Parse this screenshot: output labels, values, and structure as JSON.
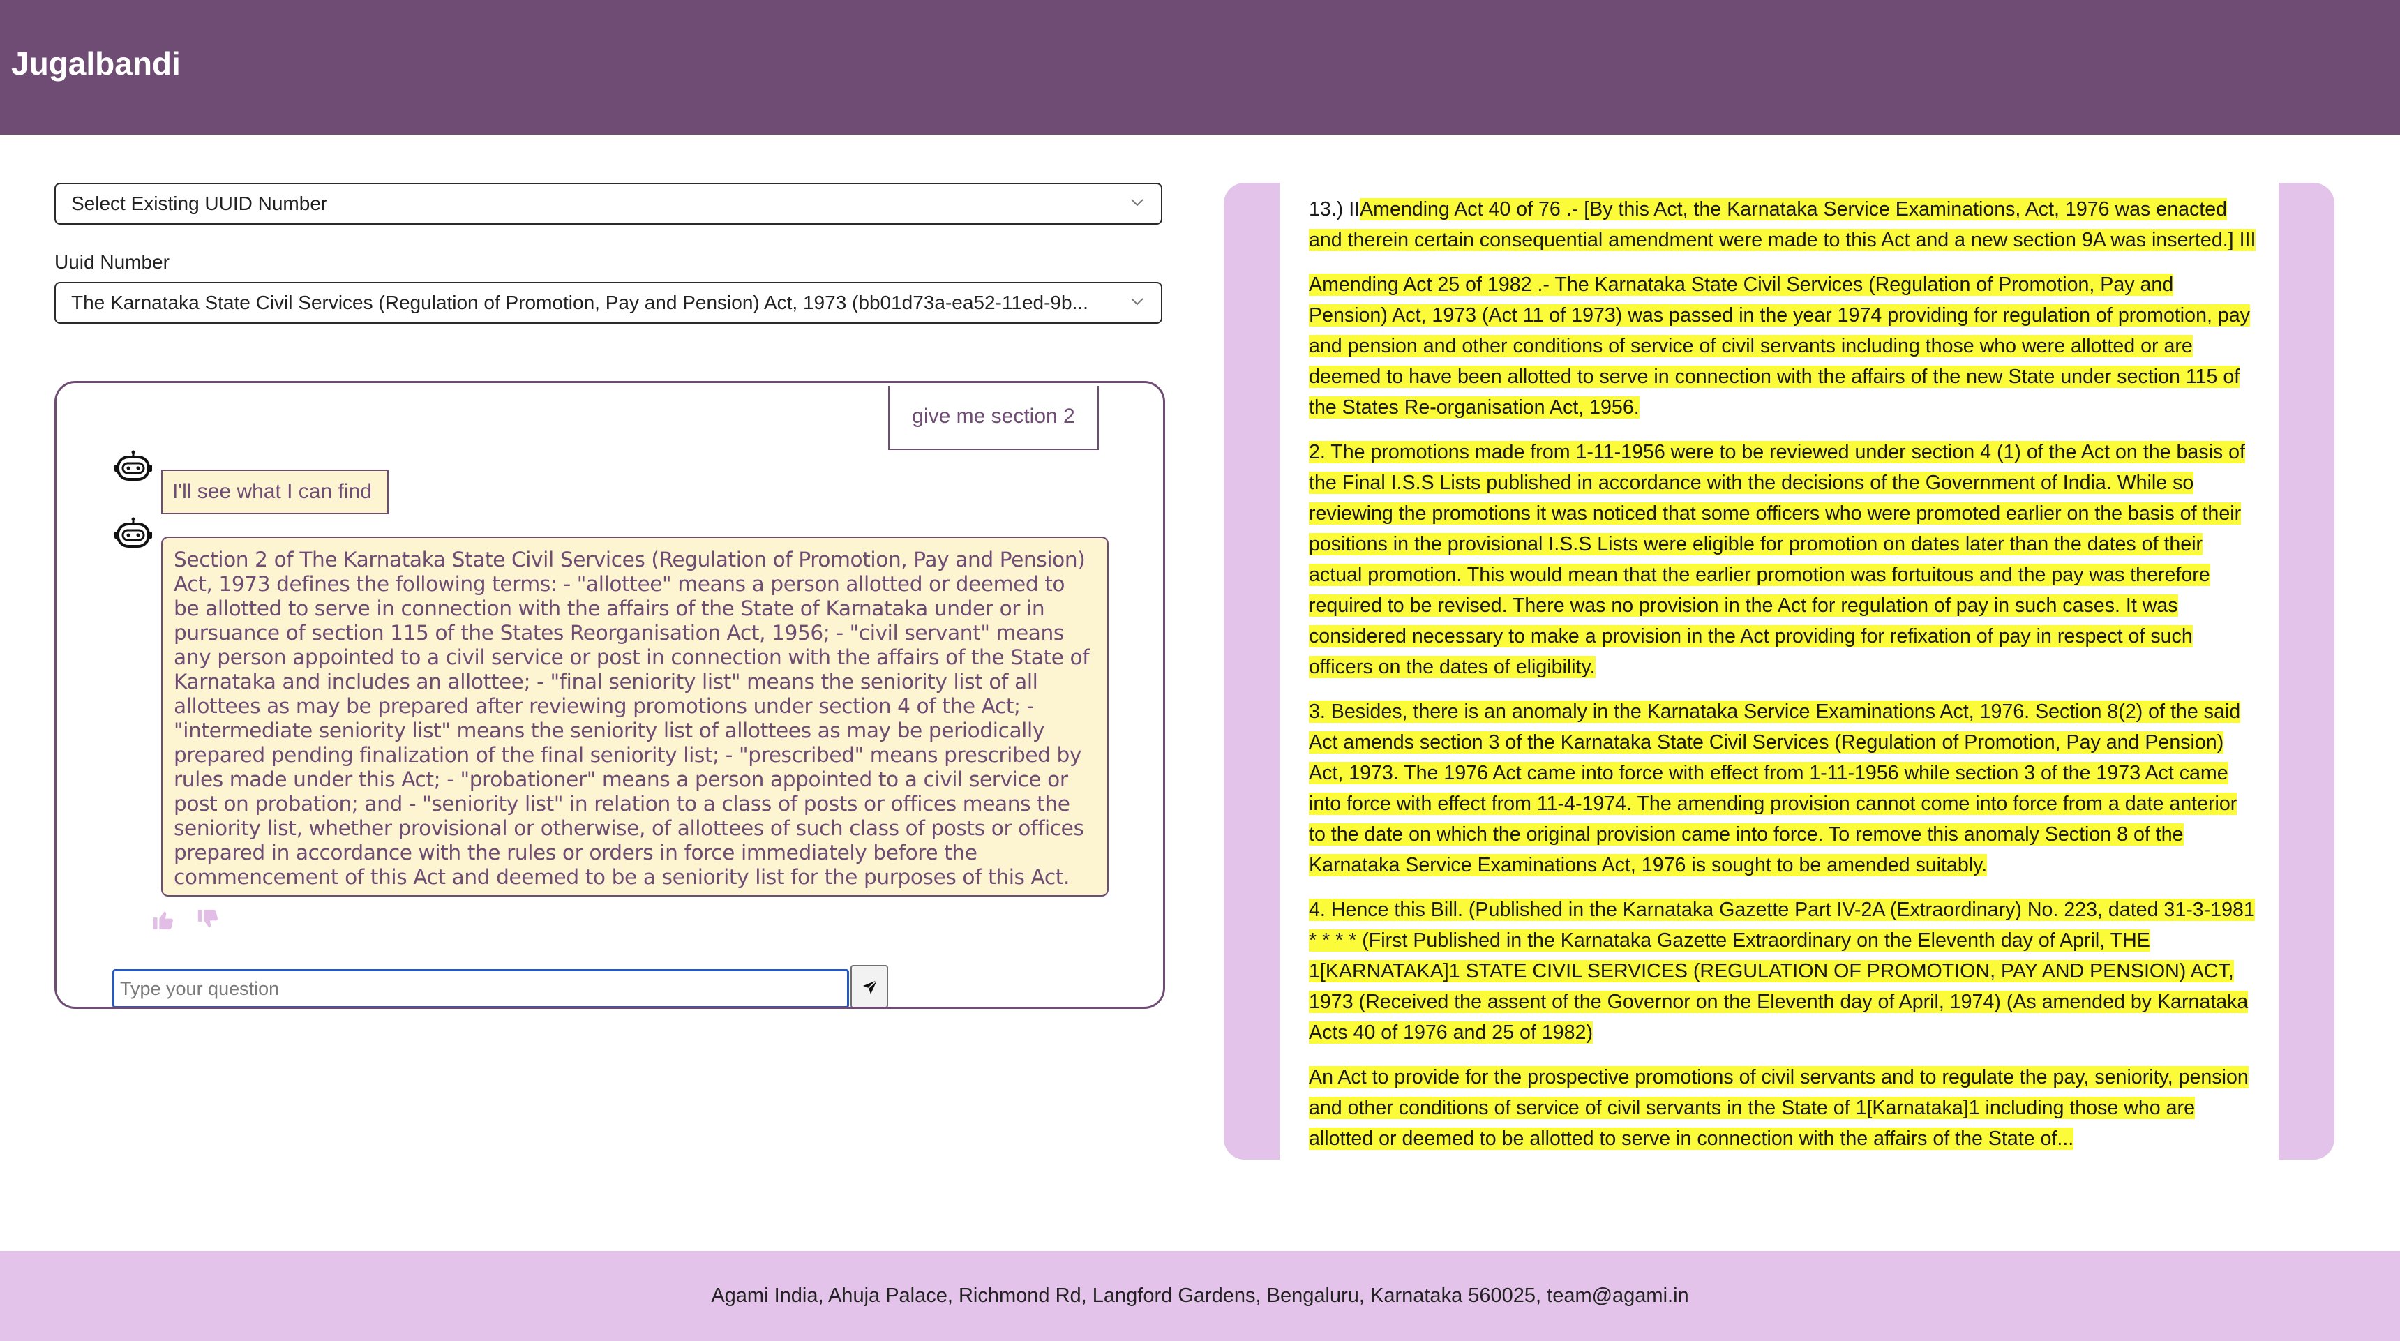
{
  "header": {
    "title": "Jugalbandi"
  },
  "uuid_select": {
    "placeholder_label": "Select Existing UUID Number"
  },
  "uuid_field": {
    "label": "Uuid Number",
    "value": "The Karnataka State Civil Services (Regulation of Promotion, Pay and Pension) Act, 1973 (bb01d73a-ea52-11ed-9b..."
  },
  "chat": {
    "messages": [
      {
        "role": "user",
        "text": "give me section 2"
      },
      {
        "role": "bot",
        "text": "I'll see what I can find"
      },
      {
        "role": "bot",
        "text": "Section 2 of The Karnataka State Civil Services (Regulation of Promotion, Pay and Pension) Act, 1973 defines the following terms: - \"allottee\" means a person allotted or deemed to be allotted to serve in connection with the affairs of the State of Karnataka under or in pursuance of section 115 of the States Reorganisation Act, 1956; - \"civil servant\" means any person appointed to a civil service or post in connection with the affairs of the State of Karnataka and includes an allottee; - \"final seniority list\" means the seniority list of all allottees as may be prepared after reviewing promotions under section 4 of the Act; - \"intermediate seniority list\" means the seniority list of allottees as may be periodically prepared pending finalization of the final seniority list; - \"prescribed\" means prescribed by rules made under this Act; - \"probationer\" means a person appointed to a civil service or post on probation; and - \"seniority list\" in relation to a class of posts or offices means the seniority list, whether provisional or otherwise, of allottees of such class of posts or offices prepared in accordance with the rules or orders in force immediately before the commencement of this Act and deemed to be a seniority list for the purposes of this Act."
      }
    ],
    "input_placeholder": "Type your question",
    "icons": {
      "bot": "robot-icon",
      "like": "thumbs-up-icon",
      "dislike": "thumbs-down-icon",
      "send": "send-icon"
    }
  },
  "document": {
    "top_fragment": "13.) II",
    "paragraphs": [
      "Amending Act 40 of 76 .- [By this Act, the Karnataka Service Examinations, Act, 1976 was enacted and therein certain consequential amendment were made to this Act and a new section 9A was inserted.] III",
      "Amending Act 25 of 1982 .- The Karnataka State Civil Services (Regulation of Promotion, Pay and Pension) Act, 1973 (Act 11 of 1973) was passed in the year 1974 providing for regulation of promotion, pay and pension and other conditions of service of civil servants including those who were allotted or are deemed to have been allotted to serve in connection with the affairs of the new State under section 115 of the States Re-organisation Act, 1956.",
      "2. The promotions made from 1-11-1956 were to be reviewed under section 4 (1) of the Act on the basis of the Final I.S.S Lists published in accordance with the decisions of the Government of India. While so reviewing the promotions it was noticed that some officers who were promoted earlier on the basis of their positions in the provisional I.S.S Lists were eligible for promotion on dates later than the dates of their actual promotion. This would mean that the earlier promotion was fortuitous and the pay was therefore required to be revised. There was no provision in the Act for regulation of pay in such cases. It was considered necessary to make a provision in the Act providing for refixation of pay in respect of such officers on the dates of eligibility.",
      "3. Besides, there is an anomaly in the Karnataka Service Examinations Act, 1976. Section 8(2) of the said Act amends section 3 of the Karnataka State Civil Services (Regulation of Promotion, Pay and Pension) Act, 1973. The 1976 Act came into force with effect from 1-11-1956 while section 3 of the 1973 Act came into force with effect from 11-4-1974. The amending provision cannot come into force from a date anterior to the date on which the original provision came into force. To remove this anomaly Section 8 of the Karnataka Service Examinations Act, 1976 is sought to be amended suitably.",
      "4. Hence this Bill. (Published in the Karnataka Gazette Part IV-2A (Extraordinary) No. 223, dated 31-3-1981 * * * * (First Published in the Karnataka Gazette Extraordinary on the Eleventh day of April, THE 1[KARNATAKA]1 STATE CIVIL SERVICES (REGULATION OF PROMOTION, PAY AND PENSION) ACT, 1973 (Received the assent of the Governor on the Eleventh day of April, 1974) (As amended by Karnataka Acts 40 of 1976 and 25 of 1982)",
      "An Act to provide for the prospective promotions of civil servants and to regulate the pay, seniority, pension and other conditions of service of civil servants in the State of 1[Karnataka]1 including those who are allotted or deemed to be allotted to serve in connection with the affairs of the State of..."
    ],
    "highlight_color": "#fbfb3a"
  },
  "footer": {
    "address": "Agami India, Ahuja Palace, Richmond Rd, Langford Gardens, Bengaluru, Karnataka 560025, team@agami.in"
  },
  "colors": {
    "header_bg": "#6f4c74",
    "footer_bg": "#e3c3ea",
    "chat_border": "#6f4c74",
    "bot_bubble_bg": "#fdf5d2",
    "input_focus": "#2458c9"
  }
}
